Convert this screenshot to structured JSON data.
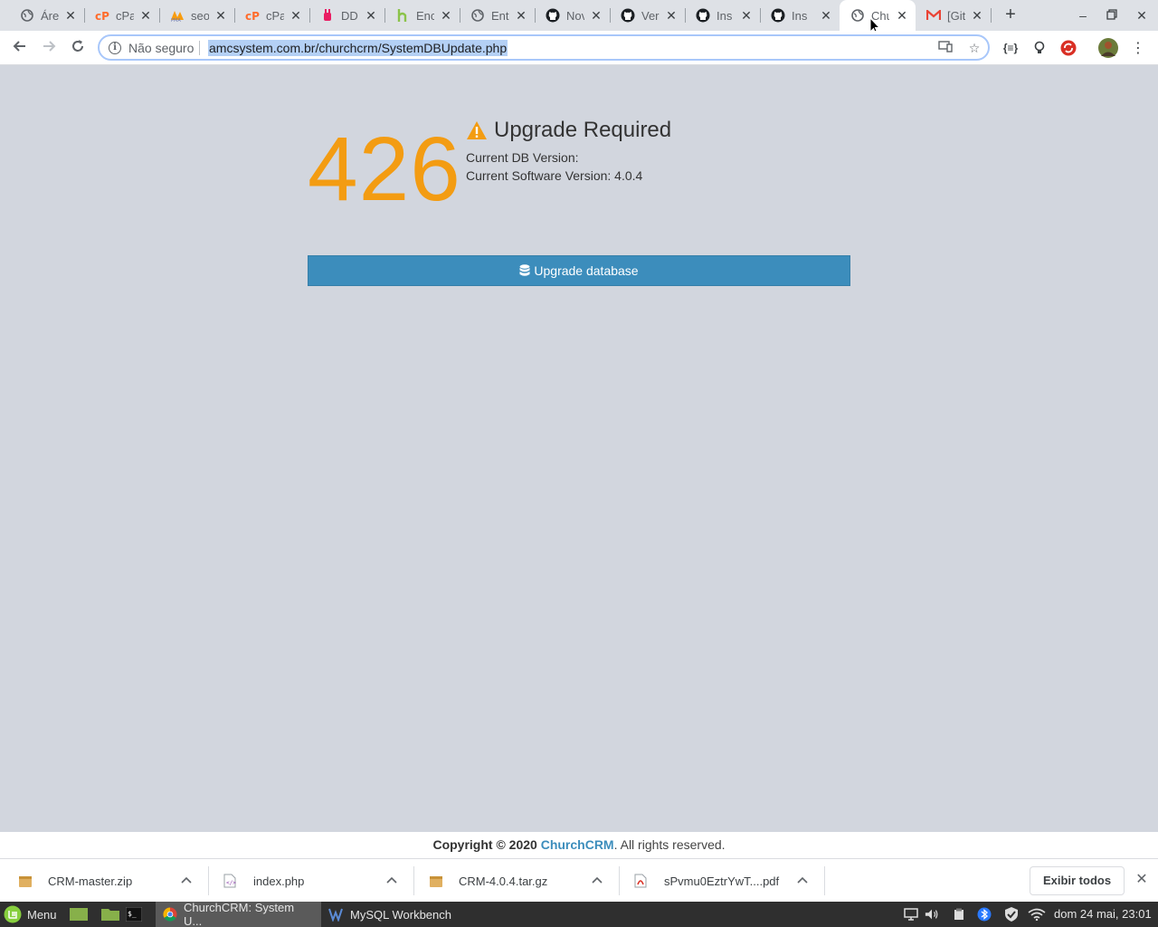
{
  "browser": {
    "tabs": [
      {
        "title": "Área",
        "icon": "globe-icon"
      },
      {
        "title": "cPa",
        "icon": "cpanel-icon"
      },
      {
        "title": "seo",
        "icon": "phpmyadmin-icon"
      },
      {
        "title": "cPa",
        "icon": "cpanel-icon"
      },
      {
        "title": "DD",
        "icon": "ddg-icon"
      },
      {
        "title": "Enc",
        "icon": "framework-icon"
      },
      {
        "title": "Ent",
        "icon": "globe-icon"
      },
      {
        "title": "Nov",
        "icon": "github-icon"
      },
      {
        "title": "Ver",
        "icon": "github-icon"
      },
      {
        "title": "Ins",
        "icon": "github-icon"
      },
      {
        "title": "Ins",
        "icon": "github-icon"
      },
      {
        "title": "Chu",
        "icon": "globe-icon",
        "active": true
      },
      {
        "title": "[Git",
        "icon": "gmail-icon"
      }
    ],
    "not_secure_label": "Não seguro",
    "url": "amcsystem.com.br/churchcrm/SystemDBUpdate.php"
  },
  "page": {
    "error_code": "426",
    "title": "Upgrade Required",
    "db_version_label": "Current DB Version:",
    "software_version_label": "Current Software Version: 4.0.4",
    "upgrade_button_label": "Upgrade database"
  },
  "footer": {
    "copyright_prefix": "Copyright © 2020",
    "brand": "ChurchCRM",
    "suffix": ". All rights reserved."
  },
  "downloads": {
    "items": [
      {
        "name": "CRM-master.zip",
        "icon": "archive-icon"
      },
      {
        "name": "index.php",
        "icon": "code-file-icon"
      },
      {
        "name": "CRM-4.0.4.tar.gz",
        "icon": "archive-icon"
      },
      {
        "name": "sPvmu0EztrYwT....pdf",
        "icon": "pdf-icon"
      }
    ],
    "show_all_label": "Exibir todos"
  },
  "taskbar": {
    "menu_label": "Menu",
    "tasks": [
      {
        "label": "ChurchCRM: System U...",
        "active": true
      },
      {
        "label": "MySQL Workbench",
        "active": false
      }
    ],
    "clock": "dom 24 mai, 23:01"
  },
  "colors": {
    "accent": "#3c8dbc",
    "warning": "#f39c12",
    "page_bg": "#d2d6de"
  }
}
